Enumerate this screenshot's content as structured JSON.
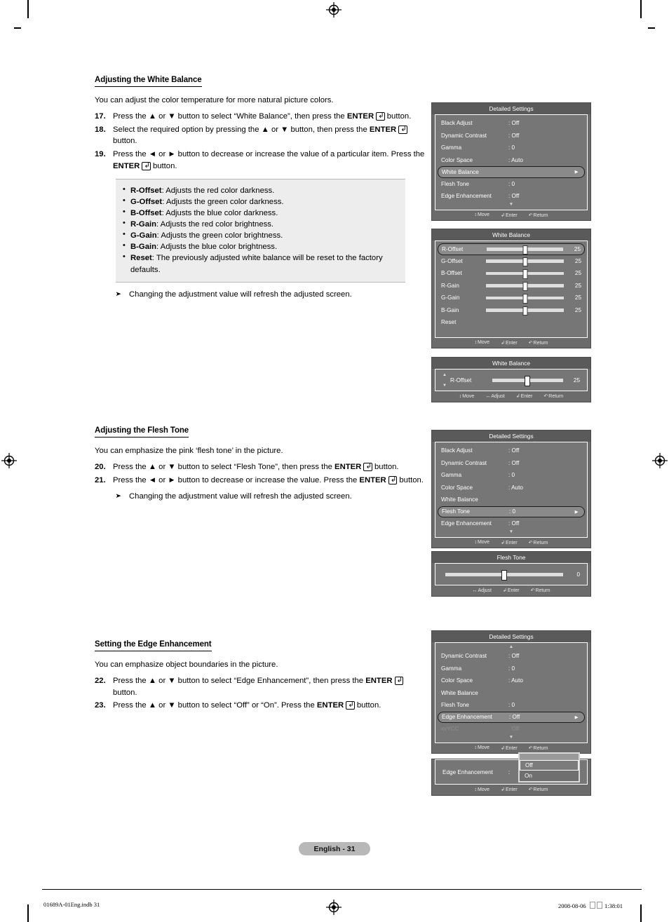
{
  "document": {
    "page_badge": "English - 31",
    "footer_left": "01689A-01Eng.indb   31",
    "footer_right_date": "2008-08-06",
    "footer_right_time": "1:38:01"
  },
  "sections": [
    {
      "heading": "Adjusting the White Balance",
      "intro": "You can adjust the color temperature for more natural picture colors.",
      "steps": [
        {
          "num": "17.",
          "text_a": "Press the ▲ or ▼ button to select “White Balance”, then press the ",
          "bold": "ENTER",
          "text_b": " button."
        },
        {
          "num": "18.",
          "text_a": "Select the required option by pressing the ▲ or ▼ button, then press the ",
          "bold": "ENTER",
          "text_b": " button."
        },
        {
          "num": "19.",
          "text_a": "Press the ◄ or ► button to decrease or increase the value of a particular item. Press the ",
          "bold": "ENTER",
          "text_b": " button."
        }
      ],
      "definitions": [
        {
          "term": "R-Offset",
          "desc": ": Adjusts the red color darkness."
        },
        {
          "term": "G-Offset",
          "desc": ": Adjusts the green color darkness."
        },
        {
          "term": "B-Offset",
          "desc": ": Adjusts the blue color darkness."
        },
        {
          "term": "R-Gain",
          "desc": ": Adjusts the red color brightness."
        },
        {
          "term": "G-Gain",
          "desc": ": Adjusts the green color brightness."
        },
        {
          "term": "B-Gain",
          "desc": ": Adjusts the blue color brightness."
        },
        {
          "term": "Reset",
          "desc": ": The previously adjusted white balance will be reset to the factory defaults."
        }
      ],
      "note": "Changing the adjustment value will refresh the adjusted screen."
    },
    {
      "heading": "Adjusting the Flesh Tone",
      "intro": "You can emphasize the pink ‘flesh tone’ in the picture.",
      "steps": [
        {
          "num": "20.",
          "text_a": "Press the ▲ or ▼ button to select “Flesh Tone”, then press the ",
          "bold": "ENTER",
          "text_b": " button."
        },
        {
          "num": "21.",
          "text_a": "Press the ◄ or ► button to decrease or increase the value. Press the ",
          "bold": "ENTER",
          "text_b": " button."
        }
      ],
      "note": "Changing the adjustment value will refresh the adjusted screen."
    },
    {
      "heading": "Setting the Edge Enhancement",
      "intro": "You can emphasize object boundaries in the picture.",
      "steps": [
        {
          "num": "22.",
          "text_a": "Press the ▲ or ▼ button to select “Edge Enhancement”, then press the ",
          "bold": "ENTER",
          "text_b": " button."
        },
        {
          "num": "23.",
          "text_a": "Press the ▲ or ▼ button to select “Off” or “On”. Press the ",
          "bold": "ENTER",
          "text_b": " button."
        }
      ]
    }
  ],
  "osd_footer": {
    "move": "Move",
    "adjust": "Adjust",
    "enter": "Enter",
    "return": "Return"
  },
  "osd": {
    "detailed_settings_white_balance": {
      "title": "Detailed Settings",
      "rows": [
        {
          "label": "Black Adjust",
          "value": ": Off"
        },
        {
          "label": "Dynamic Contrast",
          "value": ": Off"
        },
        {
          "label": "Gamma",
          "value": ": 0"
        },
        {
          "label": "Color Space",
          "value": ": Auto"
        },
        {
          "label": "White Balance",
          "value": ""
        },
        {
          "label": "Flesh Tone",
          "value": ": 0"
        },
        {
          "label": "Edge Enhancement",
          "value": ": Off"
        }
      ],
      "selected_index": 4,
      "scroll_down": true
    },
    "white_balance_list": {
      "title": "White Balance",
      "sliders": [
        {
          "label": "R-Offset",
          "value": "25",
          "percent": 50
        },
        {
          "label": "G-Offset",
          "value": "25",
          "percent": 50
        },
        {
          "label": "B-Offset",
          "value": "25",
          "percent": 50
        },
        {
          "label": "R-Gain",
          "value": "25",
          "percent": 50
        },
        {
          "label": "G-Gain",
          "value": "25",
          "percent": 50
        },
        {
          "label": "B-Gain",
          "value": "25",
          "percent": 50
        }
      ],
      "reset_label": "Reset",
      "selected_index": 0
    },
    "white_balance_adjust": {
      "title": "White Balance",
      "label": "R-Offset",
      "value": "25",
      "percent": 50
    },
    "detailed_settings_flesh_tone": {
      "title": "Detailed Settings",
      "rows": [
        {
          "label": "Black Adjust",
          "value": ": Off"
        },
        {
          "label": "Dynamic Contrast",
          "value": ": Off"
        },
        {
          "label": "Gamma",
          "value": ": 0"
        },
        {
          "label": "Color Space",
          "value": ": Auto"
        },
        {
          "label": "White Balance",
          "value": ""
        },
        {
          "label": "Flesh Tone",
          "value": ": 0"
        },
        {
          "label": "Edge Enhancement",
          "value": ": Off"
        }
      ],
      "selected_index": 5,
      "scroll_down": true
    },
    "flesh_tone_adjust": {
      "title": "Flesh Tone",
      "value": "0",
      "percent": 50
    },
    "detailed_settings_edge": {
      "title": "Detailed Settings",
      "rows": [
        {
          "label": "Dynamic Contrast",
          "value": ": Off"
        },
        {
          "label": "Gamma",
          "value": ": 0"
        },
        {
          "label": "Color Space",
          "value": ": Auto"
        },
        {
          "label": "White Balance",
          "value": ""
        },
        {
          "label": "Flesh Tone",
          "value": ": 0"
        },
        {
          "label": "Edge Enhancement",
          "value": ": Off"
        },
        {
          "label": "xvYCC",
          "value": ": Off",
          "dim": true
        }
      ],
      "selected_index": 5,
      "scroll_up": true,
      "scroll_down": true
    },
    "edge_enhancement_dropdown": {
      "label": "Edge Enhancement",
      "value_colon": ":",
      "options": [
        "Off",
        "On"
      ],
      "selected_index": 0
    }
  }
}
